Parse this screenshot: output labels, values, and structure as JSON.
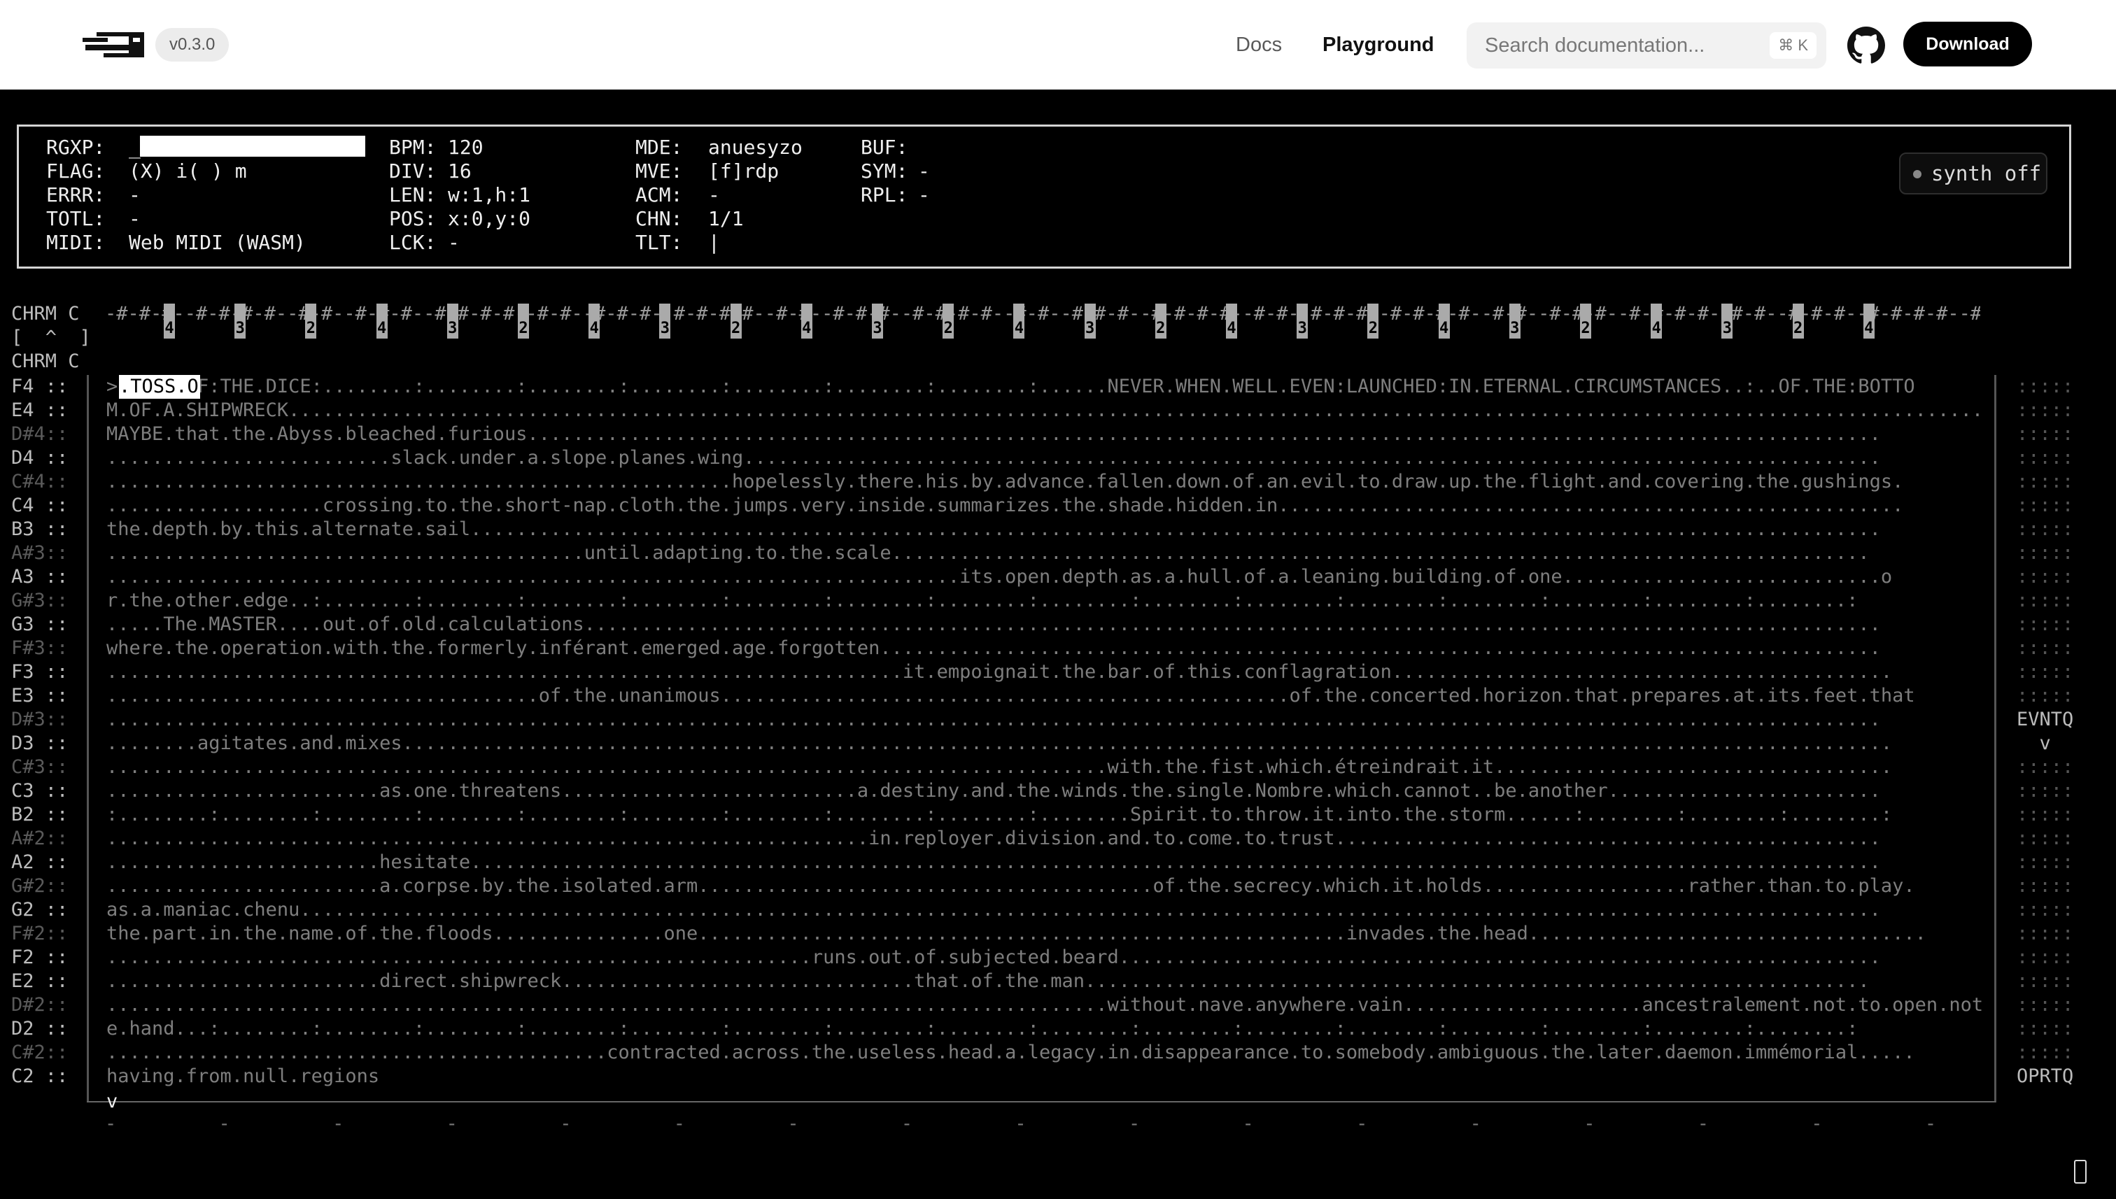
{
  "header": {
    "version": "v0.3.0",
    "nav": [
      "Docs",
      "Playground"
    ],
    "search_placeholder": "Search documentation...",
    "search_shortcut": "⌘ K",
    "download_label": "Download"
  },
  "status": {
    "col1": [
      [
        "RGXP:",
        "_"
      ],
      [
        "FLAG:",
        "(X) i( ) m"
      ],
      [
        "ERRR:",
        "-"
      ],
      [
        "TOTL:",
        "-"
      ],
      [
        "MIDI:",
        "Web MIDI (WASM)"
      ]
    ],
    "col2": [
      [
        "BPM:",
        "120"
      ],
      [
        "DIV:",
        "16"
      ],
      [
        "LEN:",
        "w:1,h:1"
      ],
      [
        "POS:",
        "x:0,y:0"
      ],
      [
        "LCK:",
        "-"
      ]
    ],
    "col3": [
      [
        "MDE:",
        "anuesyzo"
      ],
      [
        "MVE:",
        "[f]rdp"
      ],
      [
        "ACM:",
        "-"
      ],
      [
        "CHN:",
        "1/1"
      ],
      [
        "TLT:",
        "|"
      ]
    ],
    "col4": [
      [
        "BUF:",
        ""
      ],
      [
        "SYM:",
        "-"
      ],
      [
        "RPL:",
        "-"
      ]
    ],
    "synth_label": "synth off"
  },
  "ruler": {
    "chrm_line1": "CHRM C",
    "chrm_line2": "[  ^  ]",
    "chrm_line3": "CHRM C",
    "pattern": "-#-#-#--#-#-#-#--#-#--#-#-#--#-#-#-#--#-#--#-#-#--#-#-#-#--#-#--#-#-#--#-#-#-#--#-#--#-#-#--#-#-#-#--#-#--#-#-#--#-#-#-#--#-#--#-#-#--#-#-#-#--#-#--#-#-#--#-#-#-#--#-#--#-#-#--#-#-#-#--#-#--#-#-#--#-#-#-#--#-#--#-#-#--#-#-#-#--#-#-",
    "markers": [
      "4",
      "3",
      "2",
      "4",
      "3",
      "2",
      "4",
      "3",
      "2",
      "4",
      "3",
      "2",
      "4",
      "3",
      "2",
      "4",
      "3",
      "2",
      "4",
      "3",
      "2",
      "4",
      "3",
      "2",
      "4"
    ]
  },
  "grid": {
    "cursor_text": ".TOSS.O",
    "caret": ">",
    "rows": [
      {
        "note": "F4 ::",
        "sharp": false,
        "text": ">.TOSS.OF:THE.DICE:........:........:........:........:........:........:........:......NEVER.WHEN.WELL.EVEN:LAUNCHED:IN.ETERNAL.CIRCUMSTANCES..:..OF.THE:BOTTO"
      },
      {
        "note": "E4 ::",
        "sharp": false,
        "text": "M.OF.A.SHIPWRECK........................................................................................................................................................"
      },
      {
        "note": "D#4::",
        "sharp": true,
        "text": "MAYBE.that.the.Abyss.bleached.furious......................................................................................................................."
      },
      {
        "note": "D4 ::",
        "sharp": false,
        "text": ".........................slack.under.a.slope.planes.wing...................................................................................................."
      },
      {
        "note": "C#4::",
        "sharp": true,
        "text": ".......................................................hopelessly.there.his.by.advance.fallen.down.of.an.evil.to.draw.up.the.flight.and.covering.the.gushings."
      },
      {
        "note": "C4 ::",
        "sharp": false,
        "text": "...................crossing.to.the.short-nap.cloth.the.jumps.very.inside.summarizes.the.shade.hidden.in......................................................."
      },
      {
        "note": "B3 ::",
        "sharp": false,
        "text": "the.depth.by.this.alternate.sail............................................................................................................................"
      },
      {
        "note": "A#3::",
        "sharp": true,
        "text": "..........................................until.adapting.to.the.scale......................................................................................"
      },
      {
        "note": "A3 ::",
        "sharp": false,
        "text": "...........................................................................its.open.depth.as.a.hull.of.a.leaning.building.of.one............................o"
      },
      {
        "note": "G#3::",
        "sharp": true,
        "text": "r.the.other.edge..:........:........:........:........:........:........:........:........:........:........:........:........:........:........:........:"
      },
      {
        "note": "G3 ::",
        "sharp": false,
        "text": ".....The.MASTER....out.of.old.calculations.................................................................................................................."
      },
      {
        "note": "F#3::",
        "sharp": true,
        "text": "where.the.operation.with.the.formerly.inférant.emerged.age.forgotten........................................................................................"
      },
      {
        "note": "F3 ::",
        "sharp": false,
        "text": "......................................................................it.empoignait.the.bar.of.this.conflagration............................................"
      },
      {
        "note": "E3 ::",
        "sharp": false,
        "text": "......................................of.the.unanimous..................................................of.the.concerted.horizon.that.prepares.at.its.feet.that"
      },
      {
        "note": "D#3::",
        "sharp": true,
        "text": "............................................................................................................................................................"
      },
      {
        "note": "D3 ::",
        "sharp": false,
        "text": "........agitates.and.mixes..................................................................................................................................."
      },
      {
        "note": "C#3::",
        "sharp": true,
        "text": "........................................................................................with.the.fist.which.étreindrait.it..................................."
      },
      {
        "note": "C3 ::",
        "sharp": false,
        "text": "........................as.one.threatens..........................a.destiny.and.the.winds.the.single.Nombre.which.cannot..be.another........................"
      },
      {
        "note": "B2 ::",
        "sharp": false,
        "text": ":........:........:........:........:........:........:........:........:........:........Spirit.to.throw.it.into.the.storm......:........:........:........:"
      },
      {
        "note": "A#2::",
        "sharp": true,
        "text": "...................................................................in.reployer.division.and.to.come.to.trust................................................"
      },
      {
        "note": "A2 ::",
        "sharp": false,
        "text": "........................hesitate............................................................................................................................"
      },
      {
        "note": "G#2::",
        "sharp": true,
        "text": "........................a.corpse.by.the.isolated.arm........................................of.the.secrecy.which.it.holds..................rather.than.to.play."
      },
      {
        "note": "G2 ::",
        "sharp": false,
        "text": "as.a.maniac.chenu..........................................................................................................................................."
      },
      {
        "note": "F#2::",
        "sharp": true,
        "text": "the.part.in.the.name.of.the.floods...............one.........................................................invades.the.head..................................."
      },
      {
        "note": "F2 ::",
        "sharp": false,
        "text": "..............................................................runs.out.of.subjected.beard..................................................................."
      },
      {
        "note": "E2 ::",
        "sharp": false,
        "text": "........................direct.shipwreck...............................that.of.the.man....................................................................."
      },
      {
        "note": "D#2::",
        "sharp": true,
        "text": "........................................................................................without.nave.anywhere.vain.....................ancestralement.not.to.open.not.th"
      },
      {
        "note": "D2 ::",
        "sharp": false,
        "text": "e.hand...:........:........:........:........:........:........:........:........:........:........:........:........:........:........:........:........:"
      },
      {
        "note": "C#2::",
        "sharp": true,
        "text": "............................................contracted.across.the.useless.head.a.legacy.in.disappearance.to.somebody.ambiguous.the.later.daemon.immémorial....."
      },
      {
        "note": "C2 ::",
        "sharp": false,
        "text": "having.from.null.regions"
      }
    ],
    "bottom_arrow": "v",
    "bottom_ticks": "-         -         -         -         -         -         -         -         -         -         -         -         -         -         -         -         -",
    "side": [
      ":::::",
      ":::::",
      ":::::",
      ":::::",
      ":::::",
      ":::::",
      ":::::",
      ":::::",
      ":::::",
      ":::::",
      ":::::",
      ":::::",
      ":::::",
      ":::::",
      "EVNTQ",
      "  v",
      ":::::",
      ":::::",
      ":::::",
      ":::::",
      ":::::",
      ":::::",
      ":::::",
      ":::::",
      ":::::",
      ":::::",
      ":::::",
      ":::::",
      ":::::",
      "OPRTQ"
    ]
  }
}
